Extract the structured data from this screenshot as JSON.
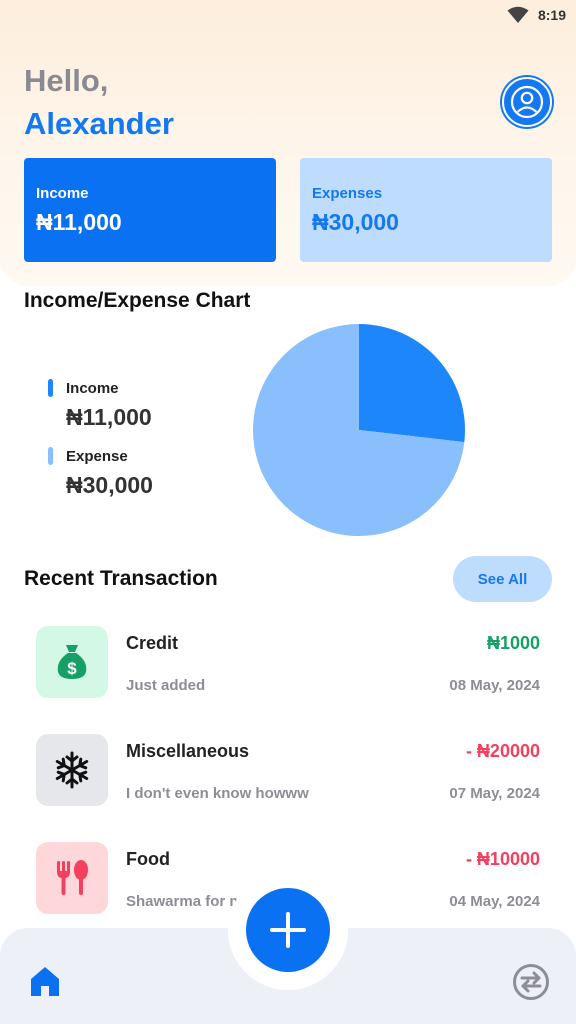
{
  "status_bar": {
    "time": "8:19",
    "wifi_icon": "wifi-icon"
  },
  "header": {
    "greeting": "Hello,",
    "username": "Alexander",
    "avatar_icon": "user-avatar-icon"
  },
  "summary": {
    "income_label": "Income",
    "income_value": "₦11,000",
    "expense_label": "Expenses",
    "expense_value": "₦30,000"
  },
  "chart_section": {
    "title": "Income/Expense Chart",
    "legend": [
      {
        "label": "Income",
        "value": "₦11,000",
        "color": "#1e86fb"
      },
      {
        "label": "Expense",
        "value": "₦30,000",
        "color": "#8abffd"
      }
    ]
  },
  "chart_data": {
    "type": "pie",
    "title": "Income/Expense Chart",
    "categories": [
      "Income",
      "Expense"
    ],
    "values": [
      11000,
      30000
    ],
    "colors": [
      "#1e86fb",
      "#8abffd"
    ],
    "legend_position": "left"
  },
  "recent": {
    "title": "Recent Transaction",
    "see_all_label": "See All",
    "transactions": [
      {
        "name": "Credit",
        "description": "Just added",
        "amount": "₦1000",
        "date": "08 May, 2024",
        "icon": "money-bag-icon",
        "amount_color": "#16a066",
        "icon_bg": "#d3f8e6",
        "icon_color": "#16a066"
      },
      {
        "name": "Miscellaneous",
        "description": "I don't even know howww",
        "amount": "- ₦20000",
        "date": "07 May, 2024",
        "icon": "snowflake-icon",
        "amount_color": "#f43f5e",
        "icon_bg": "#e5e7eb",
        "icon_color": "#111111"
      },
      {
        "name": "Food",
        "description": "Shawarma for me o",
        "amount": "- ₦10000",
        "date": "04 May, 2024",
        "icon": "fork-spoon-icon",
        "amount_color": "#f43f5e",
        "icon_bg": "#fed7da",
        "icon_color": "#f43f5e"
      }
    ]
  },
  "bottom_nav": {
    "home_icon": "home-icon",
    "add_icon": "plus-icon",
    "transfer_icon": "swap-arrows-icon"
  }
}
